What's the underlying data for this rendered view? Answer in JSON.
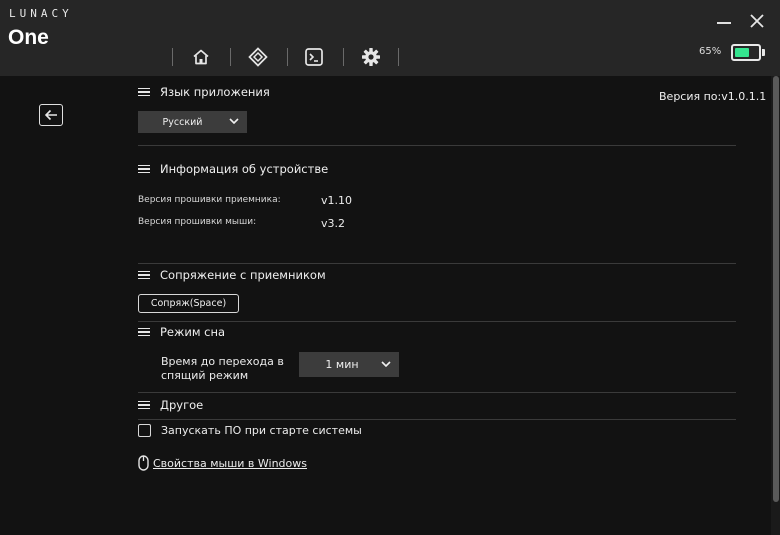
{
  "brand": {
    "top": "LUNACY",
    "main": "One"
  },
  "nav": {
    "items": [
      {
        "icon": "home-icon"
      },
      {
        "icon": "diamond-move-icon"
      },
      {
        "icon": "terminal-icon"
      },
      {
        "icon": "gear-icon"
      }
    ]
  },
  "battery": {
    "percent_label": "65%",
    "level": 0.65,
    "color": "#35e58f"
  },
  "version_label": "Версия по:v1.0.1.1",
  "sections": {
    "language": {
      "title": "Язык приложения",
      "selected": "Русский"
    },
    "device": {
      "title": "Информация об устройстве",
      "rows": [
        {
          "label": "Версия прошивки приемника:",
          "value": "v1.10"
        },
        {
          "label": "Версия прошивки мыши:",
          "value": "v3.2"
        }
      ]
    },
    "pairing": {
      "title": "Сопряжение с приемником",
      "button": "Сопряж(Space)"
    },
    "sleep": {
      "title": "Режим сна",
      "label_line1": "Время до перехода в",
      "label_line2": "спящий режим",
      "selected": "1 мин"
    },
    "other": {
      "title": "Другое",
      "autostart_label": "Запускать ПО при старте системы",
      "autostart_checked": false,
      "mouse_props_link": "Свойства мыши в Windows"
    }
  },
  "colors": {
    "background": "#121212",
    "titlebar": "#262626",
    "accent": "#35e58f",
    "dropdown": "#3c3c3c"
  }
}
